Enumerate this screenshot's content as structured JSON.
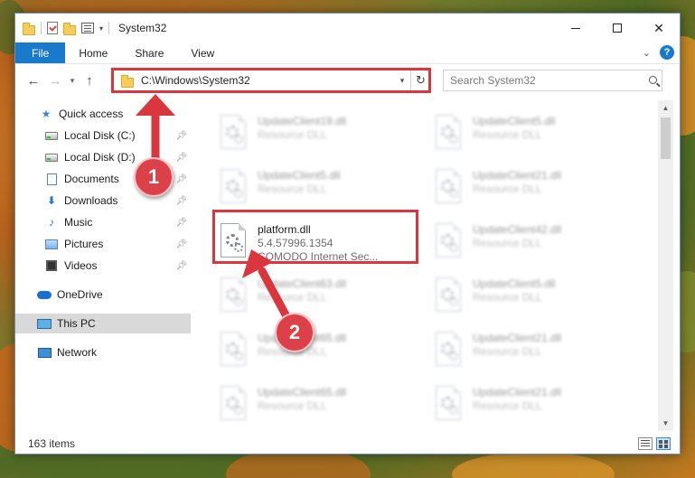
{
  "window": {
    "title": "System32",
    "controls": {
      "close": "✕"
    }
  },
  "ribbon": {
    "tabs": [
      "File",
      "Home",
      "Share",
      "View"
    ],
    "help": "?"
  },
  "address": {
    "path": "C:\\Windows\\System32"
  },
  "search": {
    "placeholder": "Search System32"
  },
  "sidebar": {
    "items": [
      {
        "label": "Quick access",
        "icon": "star-icon"
      },
      {
        "label": "Local Disk (C:)",
        "icon": "drive-icon",
        "pinned": true
      },
      {
        "label": "Local Disk (D:)",
        "icon": "drive-icon",
        "pinned": true
      },
      {
        "label": "Documents",
        "icon": "documents-icon",
        "pinned": true
      },
      {
        "label": "Downloads",
        "icon": "download-icon",
        "pinned": true
      },
      {
        "label": "Music",
        "icon": "music-icon",
        "pinned": true
      },
      {
        "label": "Pictures",
        "icon": "pictures-icon",
        "pinned": true
      },
      {
        "label": "Videos",
        "icon": "videos-icon",
        "pinned": true
      },
      {
        "label": "OneDrive",
        "icon": "onedrive-icon"
      },
      {
        "label": "This PC",
        "icon": "pc-icon",
        "selected": true
      },
      {
        "label": "Network",
        "icon": "network-icon"
      }
    ]
  },
  "files": [
    {
      "name": "UpdateClient19.dll",
      "sub1": "Resource DLL",
      "sub2": "",
      "blurred": true
    },
    {
      "name": "UpdateClient5.dll",
      "sub1": "Resource DLL",
      "sub2": "",
      "blurred": true
    },
    {
      "name": "UpdateClient5.dll",
      "sub1": "Resource DLL",
      "sub2": "",
      "blurred": true
    },
    {
      "name": "UpdateClient21.dll",
      "sub1": "Resource DLL",
      "sub2": "",
      "blurred": true
    },
    {
      "name": "platform.dll",
      "sub1": "5.4.57996.1354",
      "sub2": "COMODO Internet Sec...",
      "blurred": false
    },
    {
      "name": "UpdateClient42.dll",
      "sub1": "Resource DLL",
      "sub2": "",
      "blurred": true
    },
    {
      "name": "UpdateClient63.dll",
      "sub1": "Resource DLL",
      "sub2": "",
      "blurred": true
    },
    {
      "name": "UpdateClient5.dll",
      "sub1": "Resource DLL",
      "sub2": "",
      "blurred": true
    },
    {
      "name": "UpdateClient65.dll",
      "sub1": "Resource DLL",
      "sub2": "",
      "blurred": true
    },
    {
      "name": "UpdateClient21.dll",
      "sub1": "Resource DLL",
      "sub2": "",
      "blurred": true
    },
    {
      "name": "UpdateClient65.dll",
      "sub1": "Resource DLL",
      "sub2": "",
      "blurred": true
    },
    {
      "name": "UpdateClient21.dll",
      "sub1": "Resource DLL",
      "sub2": "",
      "blurred": true
    }
  ],
  "status": {
    "item_count": "163 items"
  },
  "annotations": {
    "step1": "1",
    "step2": "2",
    "color": "#d9363e"
  }
}
